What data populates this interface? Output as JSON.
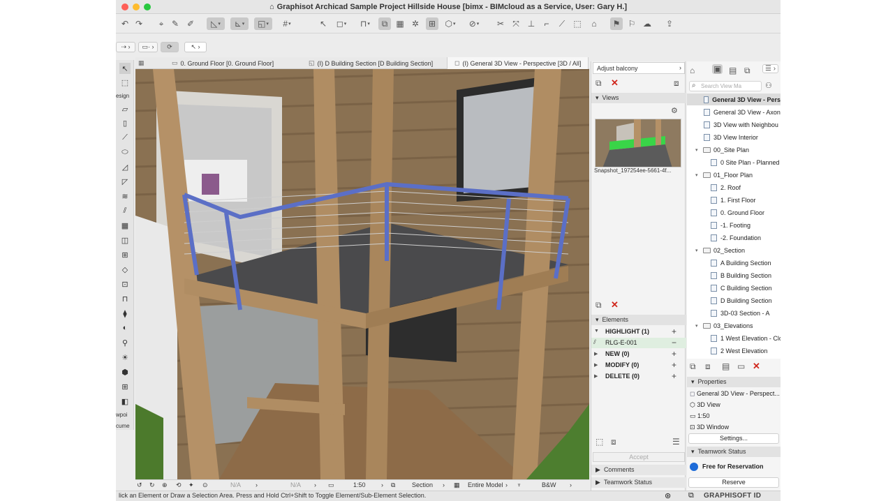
{
  "window": {
    "title": "Graphisot Archicad Sample Project Hillside House [bimx - BIMcloud as a Service, User: Gary H.]",
    "colors": {
      "close": "#fe5f57",
      "minimize": "#febc2e",
      "zoom": "#28c840"
    }
  },
  "left_tools": {
    "design_label": "esign",
    "viewpoint_label": "wpoi",
    "document_label": "cume"
  },
  "tabs": [
    {
      "label": "0. Ground Floor [0. Ground Floor]"
    },
    {
      "label": "(I) D Building Section [D Building Section]"
    },
    {
      "label": "(I) General 3D View - Perspective [3D / All]"
    }
  ],
  "view_status": {
    "scale": "1:50",
    "na1": "N/A",
    "na2": "N/A",
    "section": "Section",
    "model": "Entire Model",
    "render": "B&W"
  },
  "status_hint": "lick an Element or Draw a Selection Area. Press and Hold Ctrl+Shift to Toggle Element/Sub-Element Selection.",
  "brand": "GRAPHISOFT ID",
  "issue": {
    "title": "Adjust balcony",
    "views_header": "Views",
    "snapshot_label": "Snapshot_197254ee-5661-4f...",
    "elements_header": "Elements",
    "groups": [
      {
        "label": "HIGHLIGHT (1)",
        "sign": "+"
      },
      {
        "label": "RLG-E-001",
        "sign": "−"
      },
      {
        "label": "NEW (0)",
        "sign": "+"
      },
      {
        "label": "MODIFY (0)",
        "sign": "+"
      },
      {
        "label": "DELETE (0)",
        "sign": "+"
      }
    ],
    "accept": "Accept",
    "comments": "Comments",
    "teamwork": "Teamwork Status"
  },
  "navigator": {
    "search_placeholder": "Search View Ma",
    "items": [
      {
        "label": "General 3D View - Pers"
      },
      {
        "label": "General 3D View - Axon"
      },
      {
        "label": "3D View with Neighbou"
      },
      {
        "label": "3D View Interior"
      },
      {
        "label": "00_Site Plan"
      },
      {
        "label": "0 Site Plan - Planned"
      },
      {
        "label": "01_Floor Plan"
      },
      {
        "label": "2. Roof"
      },
      {
        "label": "1. First Floor"
      },
      {
        "label": "0. Ground Floor"
      },
      {
        "label": "-1. Footing"
      },
      {
        "label": "-2. Foundation"
      },
      {
        "label": "02_Section"
      },
      {
        "label": "A Building Section"
      },
      {
        "label": "B Building Section"
      },
      {
        "label": "C Building Section"
      },
      {
        "label": "D Building Section"
      },
      {
        "label": "3D-03 Section - A"
      },
      {
        "label": "03_Elevations"
      },
      {
        "label": "1 West Elevation - Clo"
      },
      {
        "label": "2 West Elevation"
      }
    ]
  },
  "properties": {
    "header": "Properties",
    "view_name": "General 3D View - Perspect...",
    "type": "3D View",
    "scale": "1:50",
    "window": "3D Window",
    "settings": "Settings..."
  },
  "teamwork": {
    "header": "Teamwork Status",
    "status": "Free for Reservation",
    "reserve": "Reserve"
  }
}
